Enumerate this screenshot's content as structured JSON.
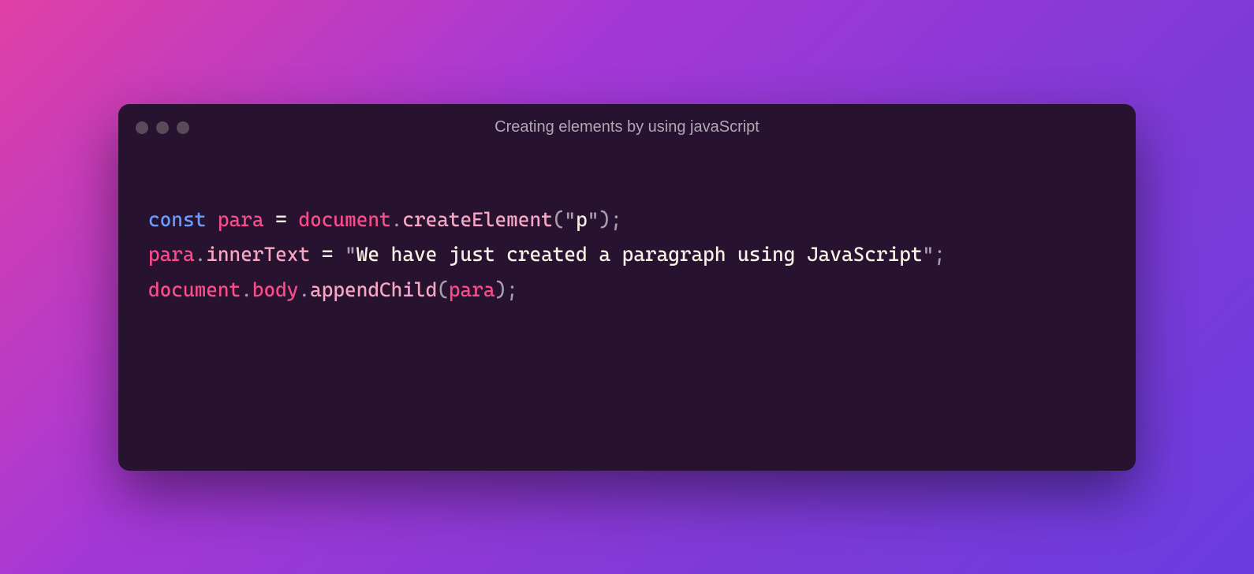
{
  "window": {
    "title": "Creating elements by using javaScript"
  },
  "code": {
    "line1": {
      "keyword": "const",
      "sp1": " ",
      "ident": "para",
      "sp2": " ",
      "assign": "=",
      "sp3": " ",
      "obj": "document",
      "dot": ".",
      "method": "createElement",
      "open": "(",
      "arg_q1": "\"",
      "arg_text": "p",
      "arg_q2": "\"",
      "close": ")",
      "semi": ";"
    },
    "line2": {
      "ident": "para",
      "dot": ".",
      "prop": "innerText",
      "sp1": " ",
      "assign": "=",
      "sp2": " ",
      "str_q1": "\"",
      "str_text": "We have just created a paragraph using JavaScript",
      "str_q2": "\"",
      "semi": ";"
    },
    "line3": {
      "obj": "document",
      "dot1": ".",
      "prop": "body",
      "dot2": ".",
      "method": "appendChild",
      "open": "(",
      "arg": "para",
      "close": ")",
      "semi": ";"
    }
  }
}
